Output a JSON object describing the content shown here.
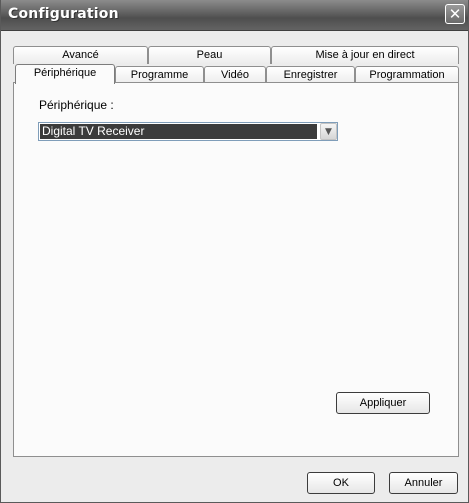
{
  "window": {
    "title": "Configuration"
  },
  "tabs_back": [
    {
      "label": "Avancé"
    },
    {
      "label": "Peau"
    },
    {
      "label": "Mise à jour en direct"
    }
  ],
  "tabs_front": [
    {
      "label": "Périphérique",
      "selected": true
    },
    {
      "label": "Programme"
    },
    {
      "label": "Vidéo"
    },
    {
      "label": "Enregistrer"
    },
    {
      "label": "Programmation"
    }
  ],
  "device_panel": {
    "label": "Périphérique :",
    "device_selected": "Digital TV Receiver",
    "apply_label": "Appliquer"
  },
  "footer": {
    "ok_label": "OK",
    "cancel_label": "Annuler"
  },
  "icons": {
    "close": "close-icon",
    "dropdown": "chevron-down-icon"
  }
}
